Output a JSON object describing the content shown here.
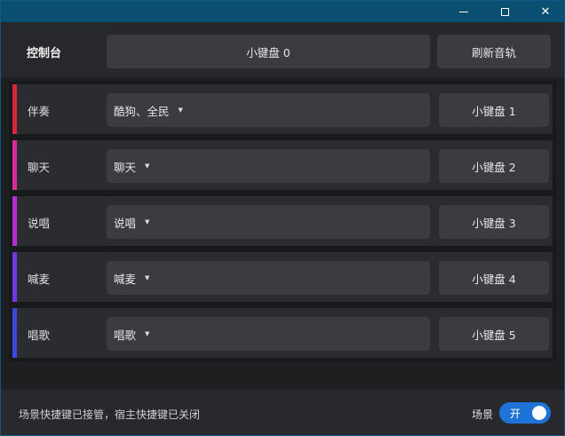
{
  "window": {
    "controls": {
      "minimize_icon": "minimize-icon",
      "maximize_icon": "maximize-icon",
      "close_icon": "close-icon",
      "close_glyph": "✕"
    }
  },
  "header": {
    "console_label": "控制台",
    "main_keyboard_label": "小键盘 0",
    "refresh_label": "刷新音轨"
  },
  "rows": [
    {
      "name": "伴奏",
      "selected": "酷狗、全民",
      "keyboard": "小键盘 1",
      "color": "#d7263d"
    },
    {
      "name": "聊天",
      "selected": "聊天",
      "keyboard": "小键盘 2",
      "color": "#d62c9a"
    },
    {
      "name": "说唱",
      "selected": "说唱",
      "keyboard": "小键盘 3",
      "color": "#b22fd6"
    },
    {
      "name": "喊麦",
      "selected": "喊麦",
      "keyboard": "小键盘 4",
      "color": "#6d3be0"
    },
    {
      "name": "唱歌",
      "selected": "唱歌",
      "keyboard": "小键盘 5",
      "color": "#3b48e0"
    }
  ],
  "footer": {
    "status_text": "场景快捷键已接管，宿主快捷键已关闭",
    "scene_label": "场景",
    "toggle_label": "开",
    "toggle_on": true,
    "accent_color": "#1e74d6"
  }
}
